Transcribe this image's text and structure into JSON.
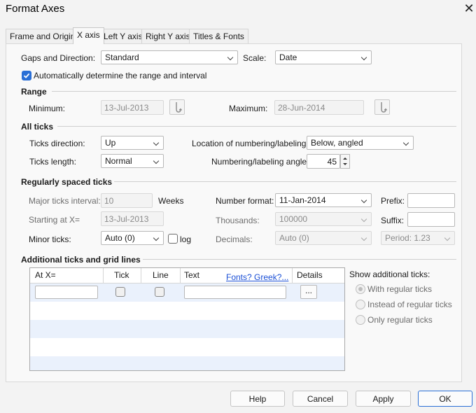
{
  "window": {
    "title": "Format Axes",
    "close_glyph": "✕"
  },
  "tabs": [
    {
      "label": "Frame and Origin"
    },
    {
      "label": "X axis"
    },
    {
      "label": "Left Y axis"
    },
    {
      "label": "Right Y axis"
    },
    {
      "label": "Titles & Fonts"
    }
  ],
  "gaps": {
    "label": "Gaps and Direction:",
    "value": "Standard"
  },
  "scale": {
    "label": "Scale:",
    "value": "Date"
  },
  "auto": {
    "label": "Automatically determine the range and interval",
    "checked": true
  },
  "range": {
    "heading": "Range",
    "min_label": "Minimum:",
    "min_value": "13-Jul-2013",
    "max_label": "Maximum:",
    "max_value": "28-Jun-2014"
  },
  "all_ticks": {
    "heading": "All ticks",
    "direction_label": "Ticks direction:",
    "direction_value": "Up",
    "length_label": "Ticks length:",
    "length_value": "Normal",
    "location_label": "Location of numbering/labeling:",
    "location_value": "Below, angled",
    "angle_label": "Numbering/labeling angle:",
    "angle_value": "45"
  },
  "regular": {
    "heading": "Regularly spaced ticks",
    "major_label": "Major ticks interval:",
    "major_value": "10",
    "major_unit": "Weeks",
    "start_label": "Starting at X=",
    "start_value": "13-Jul-2013",
    "minor_label": "Minor ticks:",
    "minor_value": "Auto (0)",
    "log_label": "log",
    "numformat_label": "Number format:",
    "numformat_value": "11-Jan-2014",
    "thousands_label": "Thousands:",
    "thousands_value": "100000",
    "decimals_label": "Decimals:",
    "decimals_value": "Auto (0)",
    "prefix_label": "Prefix:",
    "prefix_value": "",
    "suffix_label": "Suffix:",
    "suffix_value": "",
    "period_value": "Period: 1.23"
  },
  "additional": {
    "heading": "Additional ticks and grid lines",
    "columns": {
      "at_x": "At X=",
      "tick": "Tick",
      "line": "Line",
      "text": "Text",
      "fonts": "Fonts? Greek?...",
      "details": "Details"
    },
    "details_button": "...",
    "show_label": "Show additional ticks:",
    "options": [
      "With regular ticks",
      "Instead of regular ticks",
      "Only regular ticks"
    ],
    "selected_option": 0
  },
  "buttons": {
    "help": "Help",
    "cancel": "Cancel",
    "apply": "Apply",
    "ok": "OK"
  },
  "colors": {
    "accent": "#2a6fd6",
    "link": "#1a4fd6",
    "row_alt": "#eaf1fc"
  }
}
